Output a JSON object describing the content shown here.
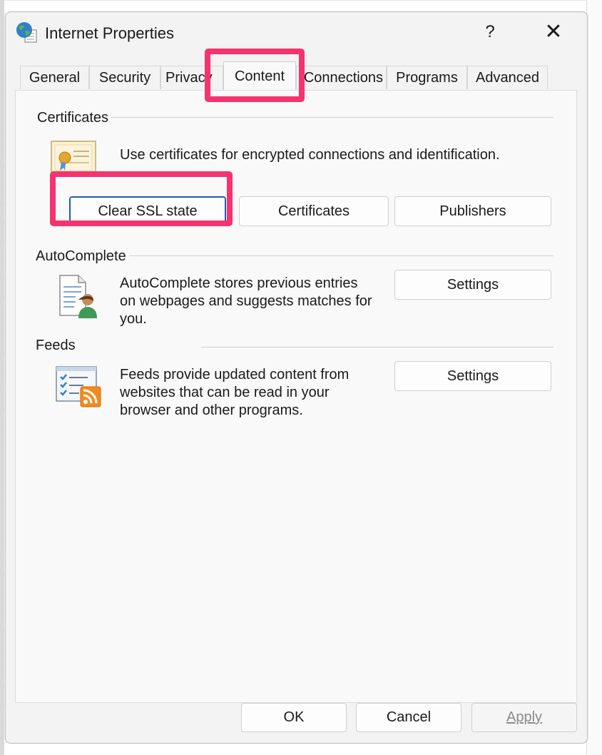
{
  "window": {
    "title": "Internet Properties",
    "help_label": "?",
    "close_label": "✕"
  },
  "tabs": [
    {
      "label": "General"
    },
    {
      "label": "Security"
    },
    {
      "label": "Privacy"
    },
    {
      "label": "Content",
      "active": true
    },
    {
      "label": "Connections"
    },
    {
      "label": "Programs"
    },
    {
      "label": "Advanced"
    }
  ],
  "certificates": {
    "heading": "Certificates",
    "description": "Use certificates for encrypted connections and identification.",
    "icon": "certificate-icon",
    "buttons": {
      "clear_ssl": "Clear SSL state",
      "certificates": "Certificates",
      "publishers": "Publishers"
    }
  },
  "autocomplete": {
    "heading": "AutoComplete",
    "description_line1": "AutoComplete stores previous entries",
    "description_line2": "on webpages and suggests matches for",
    "description_line3": "you.",
    "icon": "autocomplete-icon",
    "settings_label": "Settings"
  },
  "feeds": {
    "heading": "Feeds",
    "description_line1": "Feeds provide updated content from",
    "description_line2": "websites that can be read in your",
    "description_line3": "browser and other programs.",
    "icon": "feeds-icon",
    "settings_label": "Settings"
  },
  "footer": {
    "ok_label": "OK",
    "cancel_label": "Cancel",
    "apply_label": "Apply",
    "apply_enabled": false
  },
  "colors": {
    "highlight": "#f5336f",
    "default_button_border": "#1b5fa8"
  }
}
